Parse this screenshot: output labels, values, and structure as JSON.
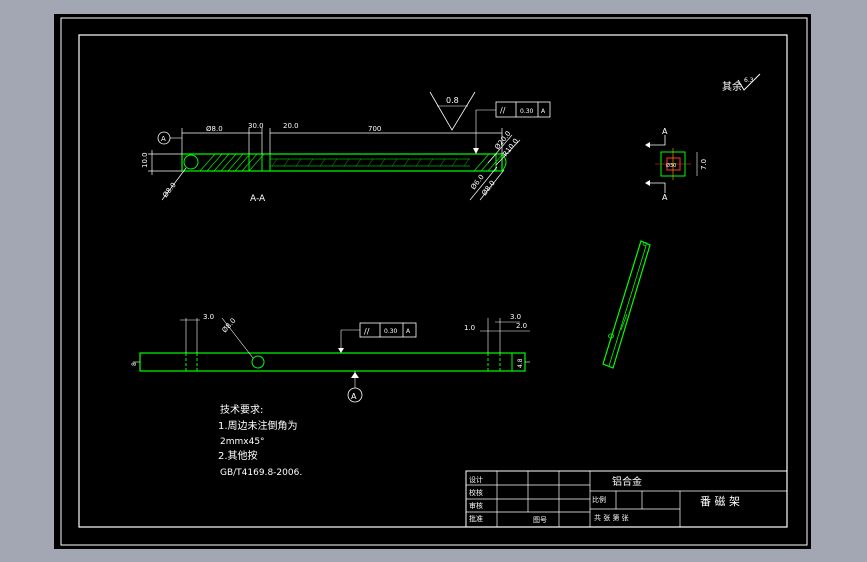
{
  "drawing": {
    "colors": {
      "background": "#a2a7b3",
      "sheet": "#000000",
      "frame": "#ffffff",
      "part": "#00ff00",
      "dimension": "#ffffff",
      "hatch": "#00ff00",
      "center_line": "#ff3333"
    },
    "surface_finish_top": "0.8",
    "roughness_other_label": "其余",
    "roughness_other_value": "6.3",
    "tolerance_top": {
      "symbol": "//",
      "value": "0.30",
      "datum": "A"
    },
    "tolerance_bottom": {
      "symbol": "//",
      "value": "0.30",
      "datum": "A"
    },
    "datum_label": "A",
    "section": {
      "title": "A-A",
      "dims": {
        "d_left_1": "Ø8.0",
        "d_left_2": "30.0",
        "d_left_3": "20.0",
        "length": "700",
        "height": "10.0",
        "hole": "Ø8.0",
        "right_1": "Ø20.0",
        "right_2": "R10.0",
        "right_3": "Ø6.0",
        "right_4": "Ø8.0"
      }
    },
    "side_view": {
      "section_marker": "A",
      "width_dim": "7.0",
      "inner_label": "Ø30"
    },
    "plan_view": {
      "left_dim": "3.0",
      "hole_dim": "Ø8.0",
      "right_dim_1": "3.0",
      "right_dim_2": "2.0",
      "right_dim_3": "1.0",
      "end_dim_left": "8",
      "end_dim_right": "4.8"
    },
    "notes": {
      "title": "技术要求:",
      "line1": "1.周边未注倒角为",
      "line2": "2mmx45°",
      "line3": "2.其他按",
      "line4": "GB/T4169.8-2006."
    },
    "title_block": {
      "design": "设计",
      "check": "校核",
      "review": "审核",
      "approve": "批准",
      "material": "铝合金",
      "part_name": "番 磁 架",
      "scale": "比例",
      "sheets": "共  张  第  张",
      "no_label": "图号"
    }
  }
}
